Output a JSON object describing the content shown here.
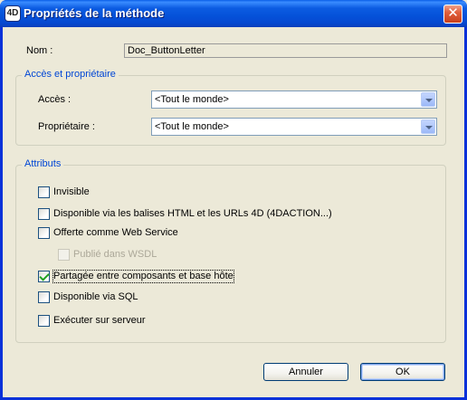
{
  "window": {
    "title": "Propriétés de la méthode",
    "app_icon_text": "4D",
    "close_glyph": "✕"
  },
  "name_field": {
    "label": "Nom :",
    "value": "Doc_ButtonLetter"
  },
  "access_group": {
    "title": "Accès et propriétaire",
    "access_label": "Accès :",
    "access_value": "<Tout le monde>",
    "owner_label": "Propriétaire :",
    "owner_value": "<Tout le monde>"
  },
  "attributes_group": {
    "title": "Attributs",
    "items": [
      {
        "label": "Invisible",
        "checked": false,
        "enabled": true
      },
      {
        "label": "Disponible via les balises HTML et les URLs 4D (4DACTION...)",
        "checked": false,
        "enabled": true
      },
      {
        "label": "Offerte comme Web Service",
        "checked": false,
        "enabled": true
      },
      {
        "label": "Publié dans WSDL",
        "checked": false,
        "enabled": false
      },
      {
        "label": "Partagée entre composants et base hôte",
        "checked": true,
        "enabled": true,
        "focused": true
      },
      {
        "label": "Disponible via SQL",
        "checked": false,
        "enabled": true
      },
      {
        "label": "Exécuter sur serveur",
        "checked": false,
        "enabled": true
      }
    ]
  },
  "buttons": {
    "cancel_label": "Annuler",
    "ok_label": "OK"
  },
  "colors": {
    "group_title": "#0046d5",
    "titlebar": "#0551d9",
    "dialog_bg": "#ece9d8"
  },
  "icons": {
    "app": "4d-app-icon",
    "close": "close-icon",
    "dropdown": "chevron-down-icon",
    "check": "checkmark-icon"
  }
}
